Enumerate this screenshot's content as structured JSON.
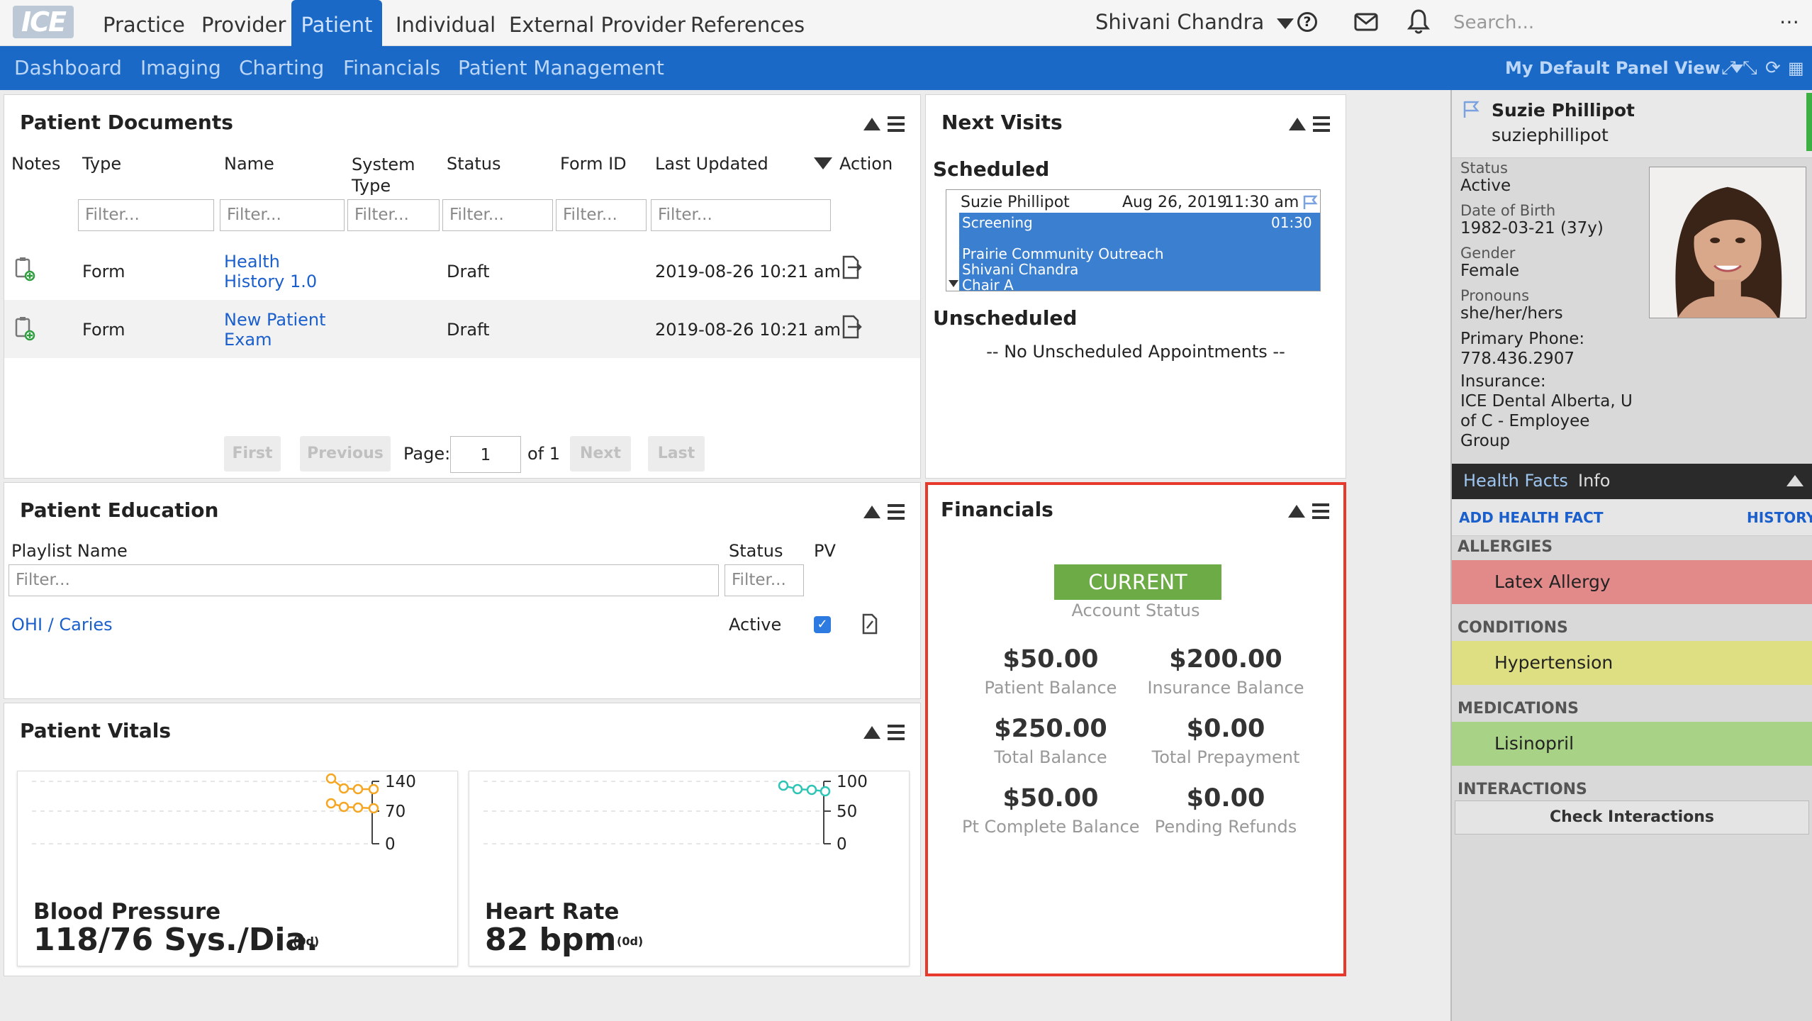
{
  "topnav": {
    "logo": "ICE",
    "items": [
      "Practice",
      "Provider",
      "Patient",
      "Individual",
      "External Provider",
      "References"
    ],
    "active": "Patient",
    "user": "Shivani Chandra",
    "search_placeholder": "Search..."
  },
  "subnav": {
    "items": [
      "Dashboard",
      "Imaging",
      "Charting",
      "Financials",
      "Patient Management"
    ],
    "panel_view": "My Default Panel View"
  },
  "documents": {
    "title": "Patient Documents",
    "columns": [
      "Notes",
      "Type",
      "Name",
      "System Type",
      "Status",
      "Form ID",
      "Last Updated",
      "Action"
    ],
    "filter_placeholder": "Filter...",
    "rows": [
      {
        "type": "Form",
        "name": "Health History 1.0",
        "status": "Draft",
        "updated": "2019-08-26 10:21 am"
      },
      {
        "type": "Form",
        "name": "New Patient Exam",
        "status": "Draft",
        "updated": "2019-08-26 10:21 am"
      }
    ],
    "pager": {
      "first": "First",
      "previous": "Previous",
      "page_label": "Page:",
      "page": "1",
      "of": "of 1",
      "next": "Next",
      "last": "Last"
    }
  },
  "visits": {
    "title": "Next Visits",
    "scheduled_label": "Scheduled",
    "appointment": {
      "patient": "Suzie Phillipot",
      "date": "Aug 26, 2019",
      "time": "11:30 am",
      "reason": "Screening",
      "duration": "01:30",
      "location": "Prairie Community Outreach",
      "provider": "Shivani Chandra",
      "chair": "Chair A"
    },
    "unscheduled_label": "Unscheduled",
    "unscheduled_empty": "-- No Unscheduled Appointments --"
  },
  "education": {
    "title": "Patient Education",
    "columns": [
      "Playlist Name",
      "Status",
      "PV"
    ],
    "filter_placeholder": "Filter...",
    "rows": [
      {
        "name": "OHI / Caries",
        "status": "Active",
        "pv": true
      }
    ]
  },
  "financials": {
    "title": "Financials",
    "status": "CURRENT",
    "status_label": "Account Status",
    "status_color": "#6cab45",
    "items": [
      {
        "amount": "$50.00",
        "label": "Patient Balance"
      },
      {
        "amount": "$200.00",
        "label": "Insurance Balance"
      },
      {
        "amount": "$250.00",
        "label": "Total Balance"
      },
      {
        "amount": "$0.00",
        "label": "Total Prepayment"
      },
      {
        "amount": "$50.00",
        "label": "Pt Complete Balance"
      },
      {
        "amount": "$0.00",
        "label": "Pending Refunds"
      }
    ]
  },
  "vitals": {
    "title": "Patient Vitals",
    "cards": [
      {
        "name": "Blood Pressure",
        "value": "118/76 Sys./Dia.",
        "age": "(0d)",
        "ticks": [
          "140",
          "70",
          "0"
        ],
        "color": "#f5a623"
      },
      {
        "name": "Heart Rate",
        "value": "82 bpm",
        "age": "(0d)",
        "ticks": [
          "100",
          "50",
          "0"
        ],
        "color": "#2ec4b6"
      }
    ]
  },
  "sidebar": {
    "name": "Suzie Phillipot",
    "username": "suziephillipot",
    "fields": [
      {
        "label": "Status",
        "value": "Active"
      },
      {
        "label": "Date of Birth",
        "value": "1982-03-21 (37y)"
      },
      {
        "label": "Gender",
        "value": "Female"
      },
      {
        "label": "Pronouns",
        "value": "she/her/hers"
      }
    ],
    "phone_label": "Primary Phone:",
    "phone": "778.436.2907",
    "insurance_label": "Insurance:",
    "insurance_lines": [
      "ICE Dental Alberta, U",
      "of C - Employee",
      "Group"
    ],
    "tabs": [
      "Health Facts",
      "Info"
    ],
    "add_health_fact": "ADD HEALTH FACT",
    "history": "HISTORY",
    "sections": [
      {
        "label": "ALLERGIES",
        "item": "Latex Allergy",
        "color": "#e28a8a"
      },
      {
        "label": "CONDITIONS",
        "item": "Hypertension",
        "color": "#dede82"
      },
      {
        "label": "MEDICATIONS",
        "item": "Lisinopril",
        "color": "#a8d285"
      }
    ],
    "interactions_label": "INTERACTIONS",
    "check_interactions": "Check Interactions"
  }
}
